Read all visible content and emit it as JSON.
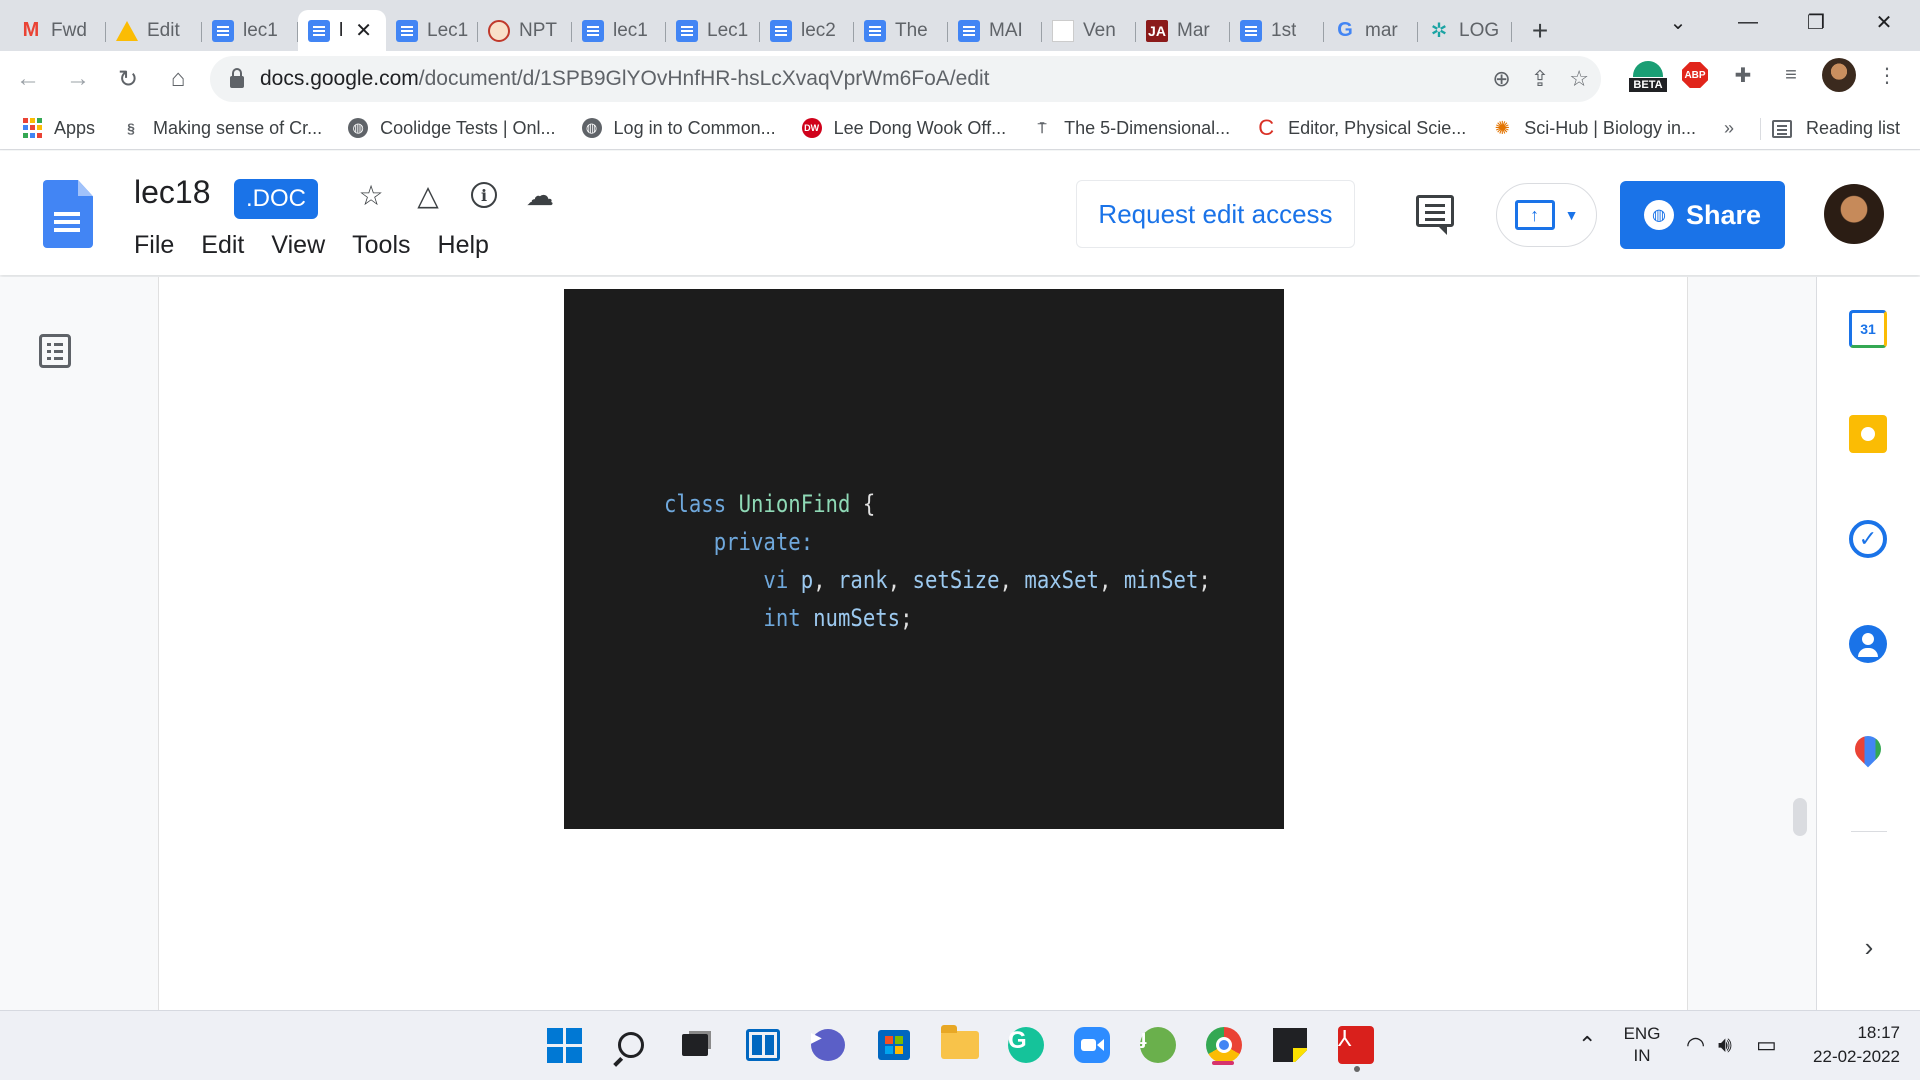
{
  "browser": {
    "tabs": [
      {
        "title": "Fwd",
        "icon": "gmail-icon"
      },
      {
        "title": "Edit",
        "icon": "drive-icon"
      },
      {
        "title": "lec1",
        "icon": "docs-icon"
      },
      {
        "title": "l",
        "icon": "docs-icon",
        "active": true
      },
      {
        "title": "Lec1",
        "icon": "docs-icon"
      },
      {
        "title": "NPT",
        "icon": "nptel-icon"
      },
      {
        "title": "lec1",
        "icon": "docs-icon"
      },
      {
        "title": "Lec1",
        "icon": "docs-icon"
      },
      {
        "title": "lec2",
        "icon": "docs-icon"
      },
      {
        "title": "The",
        "icon": "docs-icon"
      },
      {
        "title": "MAI",
        "icon": "docs-icon"
      },
      {
        "title": "Ven",
        "icon": "blank-page-icon"
      },
      {
        "title": "Mar",
        "icon": "ja-icon"
      },
      {
        "title": "1st",
        "icon": "docs-icon"
      },
      {
        "title": "mar",
        "icon": "google-icon"
      },
      {
        "title": "LOG",
        "icon": "log-icon"
      }
    ],
    "tab_favicon_text": {
      "gmail": "M",
      "ja": "JA",
      "google": "G",
      "log": "✲",
      "nptel": ""
    },
    "url_host": "docs.google.com",
    "url_path": "/document/d/1SPB9GlYOvHnfHR-hsLcXvaqVprWm6FoA/edit",
    "extensions": {
      "beta_label": "BETA",
      "abp_label": "ABP"
    },
    "bookmarks": [
      {
        "label": "Apps",
        "icon": "apps-grid-icon"
      },
      {
        "label": "Making sense of Cr...",
        "icon": "link-icon"
      },
      {
        "label": "Coolidge Tests | Onl...",
        "icon": "globe-icon"
      },
      {
        "label": "Log in to Common...",
        "icon": "globe-icon"
      },
      {
        "label": "Lee Dong Wook Off...",
        "icon": "dw-icon"
      },
      {
        "label": "The 5-Dimensional...",
        "icon": "lamp-icon"
      },
      {
        "label": "Editor, Physical Scie...",
        "icon": "c-icon"
      },
      {
        "label": "Sci-Hub | Biology in...",
        "icon": "scihub-icon"
      }
    ],
    "bookmark_icon_text": {
      "dw": "DW",
      "c": "C"
    },
    "more_bookmarks": "»",
    "reading_list": "Reading list"
  },
  "docs": {
    "title": "lec18",
    "badge": ".DOC",
    "menu": [
      "File",
      "Edit",
      "View",
      "Tools",
      "Help"
    ],
    "request_edit": "Request edit access",
    "share": "Share",
    "calendar_day": "31"
  },
  "code_image": {
    "lines": [
      [
        {
          "t": "class ",
          "c": "kw"
        },
        {
          "t": "UnionFind",
          "c": "cls"
        },
        {
          "t": " {",
          "c": "pn"
        }
      ],
      [
        {
          "t": "    private:",
          "c": "kw"
        }
      ],
      [
        {
          "t": "        vi ",
          "c": "kw"
        },
        {
          "t": "p",
          "c": "id"
        },
        {
          "t": ", ",
          "c": "pn"
        },
        {
          "t": "rank",
          "c": "id"
        },
        {
          "t": ", ",
          "c": "pn"
        },
        {
          "t": "setSize",
          "c": "id"
        },
        {
          "t": ", ",
          "c": "pn"
        },
        {
          "t": "maxSet",
          "c": "id"
        },
        {
          "t": ", ",
          "c": "pn"
        },
        {
          "t": "minSet",
          "c": "id"
        },
        {
          "t": ";",
          "c": "pn"
        }
      ],
      [
        {
          "t": "        int ",
          "c": "kw"
        },
        {
          "t": "numSets",
          "c": "id"
        },
        {
          "t": ";",
          "c": "pn"
        }
      ]
    ]
  },
  "taskbar": {
    "lang": "ENG",
    "region": "IN",
    "time": "18:17",
    "date": "22-02-2022"
  },
  "colors": {
    "accent": "#1a73e8",
    "code_bg": "#1c1c1c",
    "keyword": "#6fa8dc",
    "class_name": "#8fd9b6",
    "identifier": "#9cc9ef"
  }
}
